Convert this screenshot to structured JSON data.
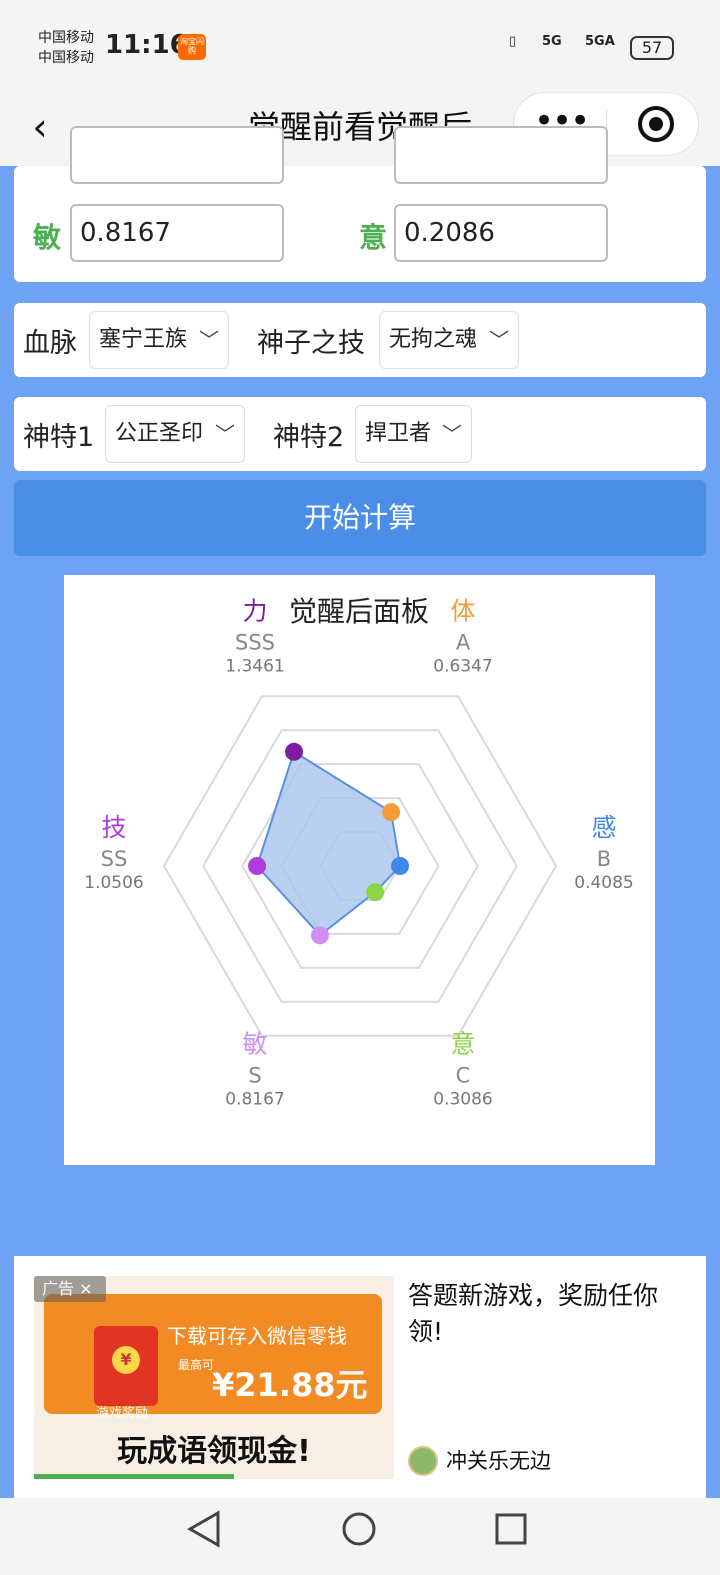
{
  "status_bar": {
    "carrier_1": "中国移动",
    "carrier_2": "中国移动",
    "time": "11:16",
    "app_badge": "淘宝闪购",
    "signal_1": "5G",
    "signal_2": "5GA",
    "battery": "57"
  },
  "nav": {
    "back_icon": "chevron-left-icon",
    "title": "觉醒前看觉醒后",
    "more_icon": "more-dots-icon",
    "target_icon": "record-target-icon"
  },
  "stats_inputs": {
    "agility_label": "敏",
    "agility_value": "0.8167",
    "will_label": "意",
    "will_value": "0.2086"
  },
  "row_bloodline": {
    "bloodline_label": "血脉",
    "bloodline_value": "塞宁王族",
    "skill_label": "神子之技",
    "skill_value": "无拘之魂"
  },
  "row_traits": {
    "trait1_label": "神特1",
    "trait1_value": "公正圣印",
    "trait2_label": "神特2",
    "trait2_value": "捍卫者"
  },
  "calc_button": "开始计算",
  "chart_data": {
    "type": "radar",
    "title": "觉醒后面板",
    "axes": [
      {
        "name": "力",
        "grade": "SSS",
        "value_label": "1.3461",
        "value": 1.3461,
        "color": "#7b1fa2"
      },
      {
        "name": "体",
        "grade": "A",
        "value_label": "0.6347",
        "value": 0.6347,
        "color": "#f39c3c"
      },
      {
        "name": "感",
        "grade": "B",
        "value_label": "0.4085",
        "value": 0.4085,
        "color": "#3f88e8"
      },
      {
        "name": "意",
        "grade": "C",
        "value_label": "0.3086",
        "value": 0.3086,
        "color": "#8bd44a"
      },
      {
        "name": "敏",
        "grade": "S",
        "value_label": "0.8167",
        "value": 0.8167,
        "color": "#cf8ff0"
      },
      {
        "name": "技",
        "grade": "SS",
        "value_label": "1.0506",
        "value": 1.0506,
        "color": "#b03ce0"
      }
    ],
    "rmax": 2.0,
    "rings": 5,
    "fill_color": "#a9c4ee",
    "line_color": "#5b8fe0"
  },
  "ad": {
    "tag": "广告",
    "tag_icon": "close-x-icon",
    "banner_line1": "下载可存入微信零钱",
    "banner_max": "最高可",
    "banner_amount": "¥21.88元",
    "banner_badge": "游戏奖励",
    "coin_symbol": "¥",
    "slogan": "玩成语领现金!",
    "headline": "答题新游戏，奖励任你领!",
    "brand": "冲关乐无边"
  }
}
